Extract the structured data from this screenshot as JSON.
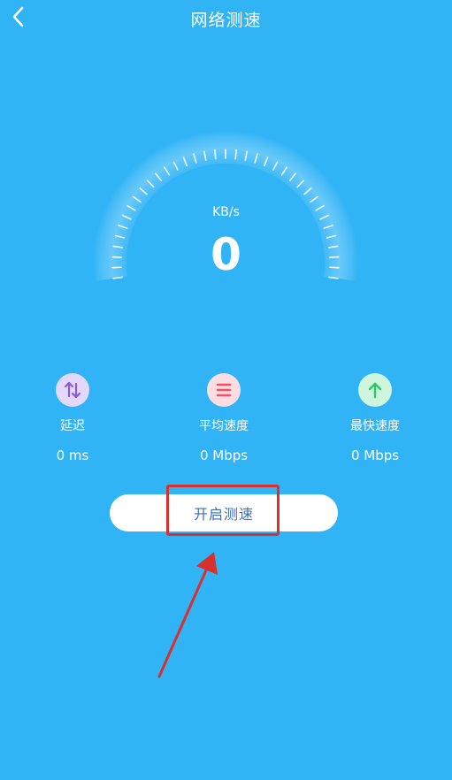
{
  "header": {
    "title": "网络测速"
  },
  "gauge": {
    "unit": "KB/s",
    "value": "0"
  },
  "stats": [
    {
      "label": "延迟",
      "value": "0 ms",
      "icon": "swap-vertical-icon",
      "color": "#8a5ad6",
      "bg": "#e3d8fb"
    },
    {
      "label": "平均速度",
      "value": "0 Mbps",
      "icon": "list-icon",
      "color": "#f24f62",
      "bg": "#fbdde2"
    },
    {
      "label": "最快速度",
      "value": "0 Mbps",
      "icon": "arrow-up-icon",
      "color": "#2fc667",
      "bg": "#cdf6dc"
    }
  ],
  "start_button": {
    "label": "开启测速"
  },
  "colors": {
    "background": "#30b4f6",
    "annotation": "#d8302d",
    "button_text": "#3a6fb8"
  }
}
